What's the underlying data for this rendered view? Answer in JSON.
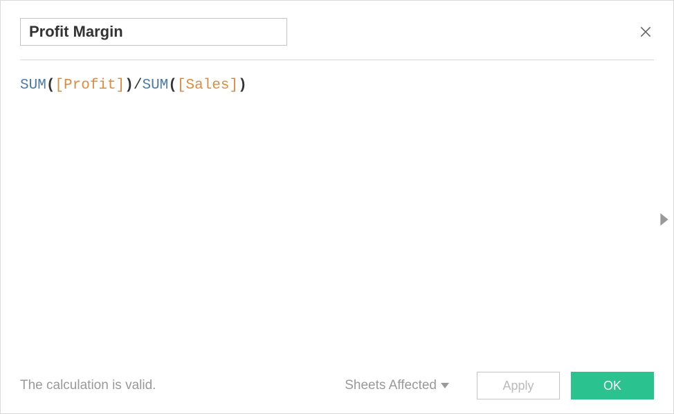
{
  "dialog": {
    "name_value": "Profit Margin",
    "formula_tokens": [
      {
        "text": "SUM",
        "cls": "tok-func"
      },
      {
        "text": "(",
        "cls": "tok-paren"
      },
      {
        "text": "[Profit]",
        "cls": "tok-field"
      },
      {
        "text": ")",
        "cls": "tok-paren"
      },
      {
        "text": "/",
        "cls": "tok-op"
      },
      {
        "text": "SUM",
        "cls": "tok-func"
      },
      {
        "text": "(",
        "cls": "tok-paren"
      },
      {
        "text": "[Sales]",
        "cls": "tok-field"
      },
      {
        "text": ")",
        "cls": "tok-paren"
      }
    ],
    "status": "The calculation is valid.",
    "sheets_label": "Sheets Affected",
    "apply_label": "Apply",
    "ok_label": "OK"
  }
}
